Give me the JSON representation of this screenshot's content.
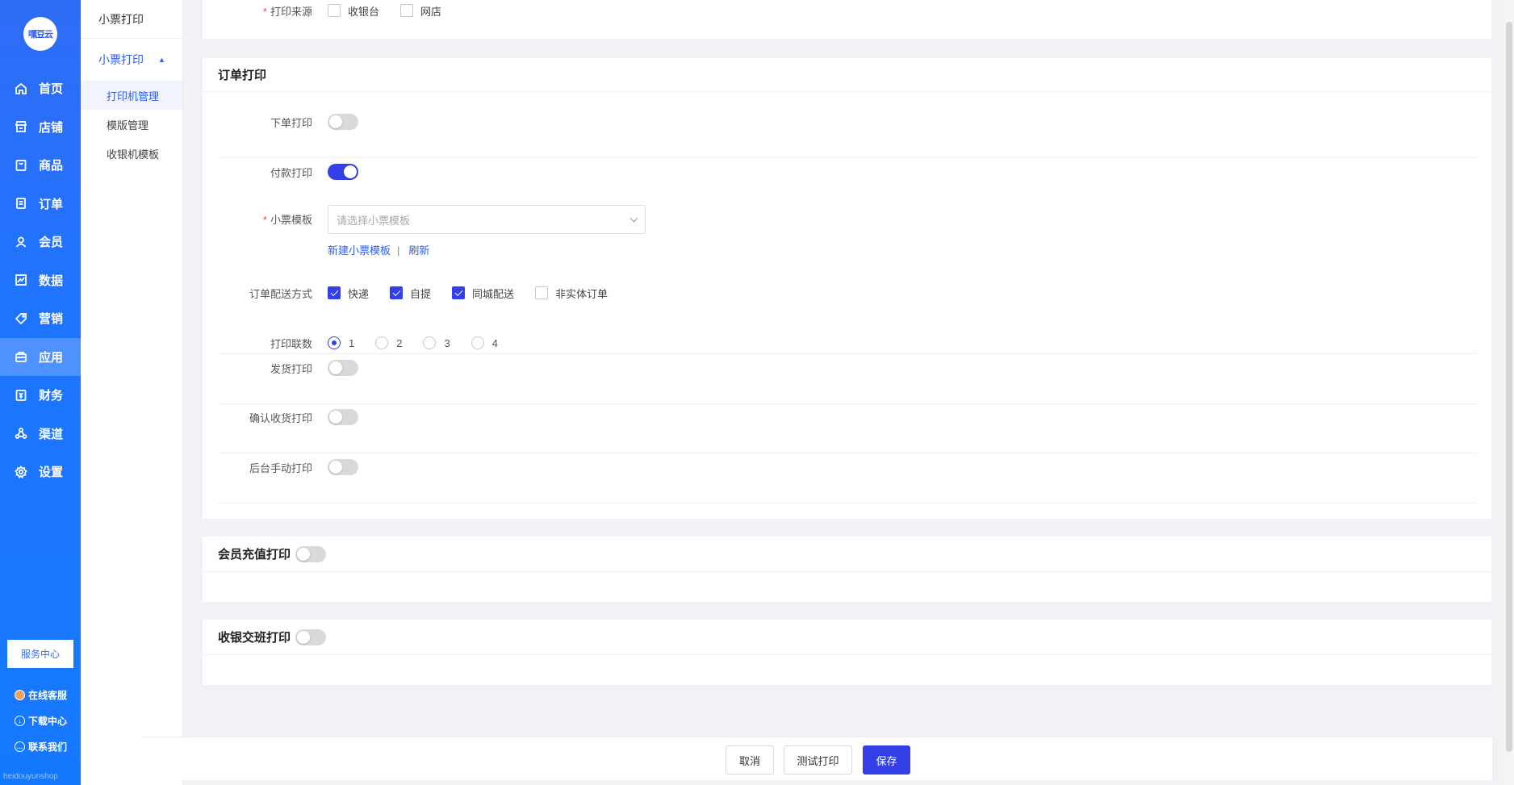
{
  "sidebar": {
    "logo_text": "嘿豆云",
    "items": [
      {
        "label": "首页",
        "icon": "home-icon"
      },
      {
        "label": "店铺",
        "icon": "shop-icon"
      },
      {
        "label": "商品",
        "icon": "product-icon"
      },
      {
        "label": "订单",
        "icon": "order-icon"
      },
      {
        "label": "会员",
        "icon": "member-icon"
      },
      {
        "label": "数据",
        "icon": "chart-icon"
      },
      {
        "label": "营销",
        "icon": "tag-icon"
      },
      {
        "label": "应用",
        "icon": "app-icon",
        "active": true
      },
      {
        "label": "财务",
        "icon": "finance-icon"
      },
      {
        "label": "渠道",
        "icon": "channel-icon"
      },
      {
        "label": "设置",
        "icon": "gear-icon"
      }
    ],
    "service_center": "服务中心",
    "links": [
      {
        "label": "在线客服",
        "icon": "support-icon"
      },
      {
        "label": "下载中心",
        "icon": "download-icon"
      },
      {
        "label": "联系我们",
        "icon": "contact-icon"
      }
    ],
    "footer_text": "heidouyunshop"
  },
  "subnav": {
    "title": "小票打印",
    "group": "小票打印",
    "items": [
      {
        "label": "打印机管理",
        "active": true
      },
      {
        "label": "模版管理"
      },
      {
        "label": "收银机模板"
      }
    ]
  },
  "top_card": {
    "source_label": "打印来源",
    "sources": [
      {
        "label": "收银台",
        "checked": false
      },
      {
        "label": "网店",
        "checked": false
      }
    ]
  },
  "order_print": {
    "title": "订单打印",
    "place_order_label": "下单打印",
    "place_order_on": false,
    "payment_label": "付款打印",
    "payment_on": true,
    "template_label": "小票模板",
    "template_placeholder": "请选择小票模板",
    "new_template_link": "新建小票模板",
    "divider": "|",
    "refresh_link": "刷新",
    "delivery_label": "订单配送方式",
    "delivery_options": [
      {
        "label": "快递",
        "checked": true
      },
      {
        "label": "自提",
        "checked": true
      },
      {
        "label": "同城配送",
        "checked": true
      },
      {
        "label": "非实体订单",
        "checked": false
      }
    ],
    "copies_label": "打印联数",
    "copies_options": [
      {
        "label": "1",
        "selected": true
      },
      {
        "label": "2"
      },
      {
        "label": "3"
      },
      {
        "label": "4"
      }
    ],
    "ship_label": "发货打印",
    "ship_on": false,
    "confirm_label": "确认收货打印",
    "confirm_on": false,
    "manual_label": "后台手动打印",
    "manual_on": false
  },
  "member_recharge": {
    "title": "会员充值打印",
    "on": false
  },
  "shift_handover": {
    "title": "收银交班打印",
    "on": false
  },
  "footer": {
    "cancel": "取消",
    "test_print": "测试打印",
    "save": "保存"
  },
  "colors": {
    "primary": "#3340e8",
    "sidebar": "#1f74ff",
    "required": "#f0483e"
  }
}
